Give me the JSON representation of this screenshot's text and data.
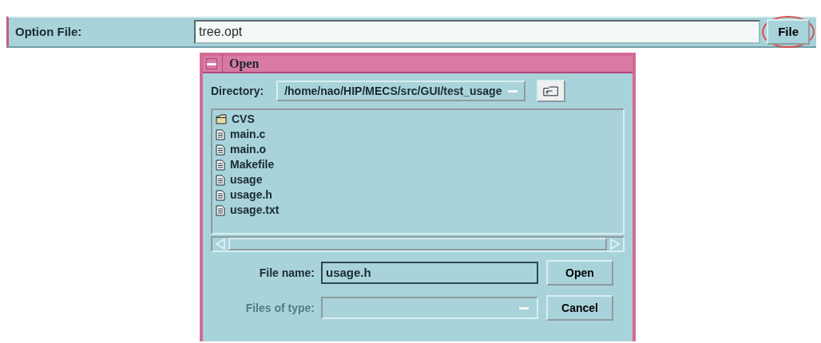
{
  "option_bar": {
    "label": "Option File:",
    "value": "tree.opt",
    "button": "File",
    "button_circled": true
  },
  "dialog": {
    "title": "Open",
    "directory": {
      "label": "Directory:",
      "value": "/home/nao/HIP/MECS/src/GUI/test_usage"
    },
    "files": [
      {
        "name": "CVS",
        "kind": "folder"
      },
      {
        "name": "main.c",
        "kind": "file"
      },
      {
        "name": "main.o",
        "kind": "file"
      },
      {
        "name": "Makefile",
        "kind": "file"
      },
      {
        "name": "usage",
        "kind": "file"
      },
      {
        "name": "usage.h",
        "kind": "file"
      },
      {
        "name": "usage.txt",
        "kind": "file"
      }
    ],
    "file_name": {
      "label": "File name:",
      "value": "usage.h"
    },
    "files_of_type": {
      "label": "Files of type:",
      "disabled": true
    },
    "buttons": [
      {
        "label": "Open"
      },
      {
        "label": "Cancel"
      }
    ]
  }
}
